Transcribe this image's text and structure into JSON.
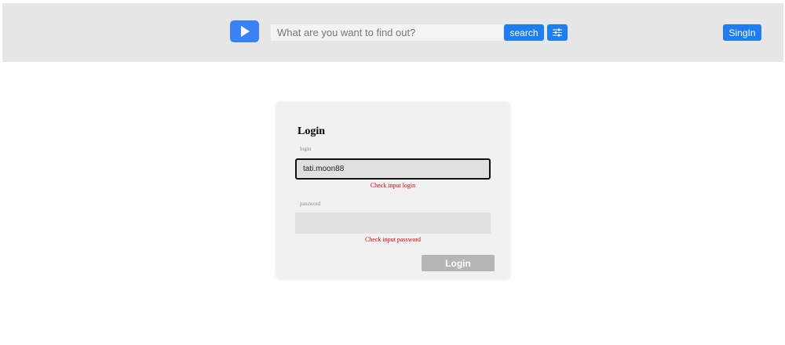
{
  "header": {
    "logo_icon": "play-icon",
    "search_placeholder": "What are you want to find out?",
    "search_label": "search",
    "filter_icon": "sliders-icon",
    "signin_label": "SingIn",
    "accent_color": "#1e7ef0"
  },
  "login_form": {
    "title": "Login",
    "login_label": "login",
    "login_value": "tati.moon88",
    "login_error": "Check input login",
    "password_label": "password",
    "password_value": "",
    "password_error": "Check input password",
    "submit_label": "Login",
    "error_color": "#e00000"
  }
}
